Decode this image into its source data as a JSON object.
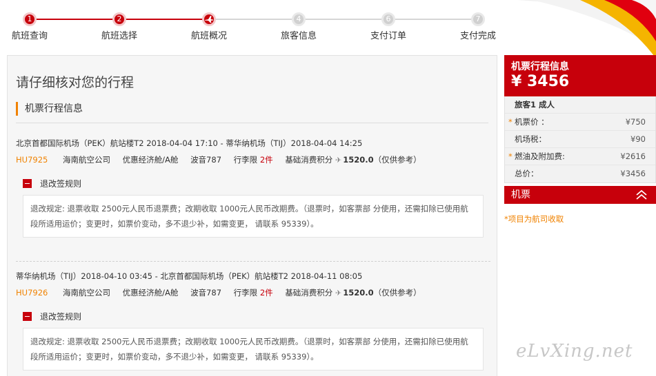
{
  "steps": [
    {
      "num": "1",
      "label": "航班查询",
      "state": "active"
    },
    {
      "num": "2",
      "label": "航班选择",
      "state": "active"
    },
    {
      "num": "",
      "label": "航班概况",
      "state": "active",
      "icon": "plane-icon"
    },
    {
      "num": "4",
      "label": "旅客信息",
      "state": "inactive"
    },
    {
      "num": "6",
      "label": "支付订单",
      "state": "inactive"
    },
    {
      "num": "7",
      "label": "支付完成",
      "state": "inactive"
    }
  ],
  "main": {
    "title": "请仔细核对您的行程",
    "section_title": "机票行程信息",
    "segments": [
      {
        "route": "北京首都国际机场（PEK）航站楼T2 2018-04-04 17:10 - 蒂华纳机场（TIJ）2018-04-04 14:25",
        "flight_no": "HU7925",
        "airline": "海南航空公司",
        "cabin": "优惠经济舱/A舱",
        "aircraft": "波音787",
        "baggage_label": "行李限",
        "baggage_value": "2件",
        "points_label": "基础消费积分",
        "points_value": "1520.0",
        "points_note": "（仅供参考）",
        "rule_title": "退改签规则",
        "rule_text": "退改规定: 退票收取 2500元人民币退票费；改期收取 1000元人民币改期费。（退票时，如客票部 分使用，还需扣除已使用航段所适用运价；变更时，如票价变动，多不退少补，如需变更， 请联系 95339）。"
      },
      {
        "route": "蒂华纳机场（TIJ）2018-04-10 03:45 - 北京首都国际机场（PEK）航站楼T2 2018-04-11 08:05",
        "flight_no": "HU7926",
        "airline": "海南航空公司",
        "cabin": "优惠经济舱/A舱",
        "aircraft": "波音787",
        "baggage_label": "行李限",
        "baggage_value": "2件",
        "points_label": "基础消费积分",
        "points_value": "1520.0",
        "points_note": "（仅供参考）",
        "rule_title": "退改签规则",
        "rule_text": "退改规定: 退票收取 2500元人民币退票费；改期收取 1000元人民币改期费。（退票时，如客票部 分使用，还需扣除已使用航段所适用运价；变更时，如票价变动，多不退少补，如需变更， 请联系 95339）。"
      }
    ]
  },
  "sidebar": {
    "title": "机票行程信息",
    "total": "¥ 3456",
    "passenger": "旅客1 成人",
    "rows": [
      {
        "label": "机票价 ：",
        "value": "¥750",
        "star": "*"
      },
      {
        "label": "机场税：",
        "value": "¥90",
        "star": ""
      },
      {
        "label": "燃油及附加费:",
        "value": "¥2616",
        "star": "*"
      },
      {
        "label": "总价：",
        "value": "¥3456",
        "star": ""
      }
    ],
    "tab_label": "机票",
    "note": "*项目为航司收取"
  },
  "watermark": "eLvXing.net",
  "colors": {
    "brand_red": "#c7000b",
    "accent_orange": "#f08200"
  }
}
